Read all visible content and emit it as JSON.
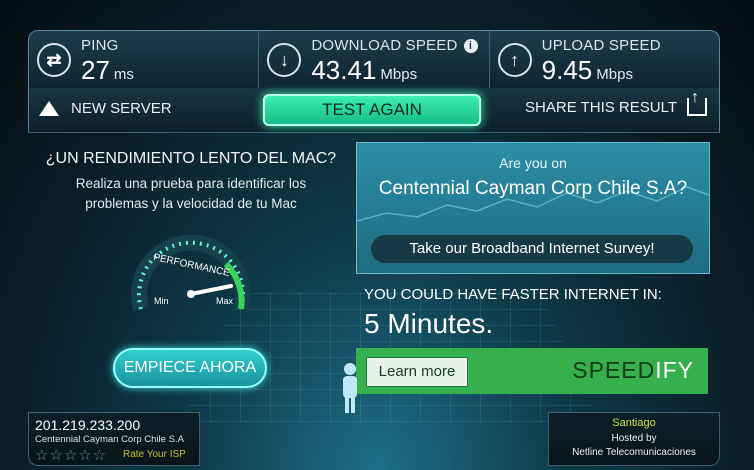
{
  "stats": [
    {
      "label": "PING",
      "value": "27",
      "unit": "ms",
      "icon": "ping-icon",
      "symbol": "⇄"
    },
    {
      "label": "DOWNLOAD SPEED",
      "value": "43.41",
      "unit": "Mbps",
      "icon": "download-arrow-icon",
      "symbol": "↓",
      "info": "i"
    },
    {
      "label": "UPLOAD SPEED",
      "value": "9.45",
      "unit": "Mbps",
      "icon": "upload-arrow-icon",
      "symbol": "↑"
    }
  ],
  "actions": {
    "new_server": "NEW SERVER",
    "test_again": "TEST AGAIN",
    "share": "SHARE THIS RESULT"
  },
  "mac_panel": {
    "title": "¿UN RENDIMIENTO LENTO DEL MAC?",
    "text": "Realiza una prueba para identificar los problemas y la velocidad de tu Mac",
    "gauge_label": "PERFORMANCE",
    "gauge_min": "Min",
    "gauge_max": "Max",
    "button": "EMPIECE AHORA"
  },
  "survey": {
    "question": "Are you on",
    "isp_name": "Centennial Cayman Corp Chile S.A?",
    "button": "Take our Broadband Internet Survey!"
  },
  "faster": {
    "line1": "YOU COULD HAVE FASTER INTERNET IN:",
    "line2": "5 Minutes."
  },
  "speedify": {
    "learn_more": "Learn more",
    "brand_dark": "SPEED",
    "brand_light": "IFY"
  },
  "isp_box": {
    "ip": "201.219.233.200",
    "name": "Centennial Cayman Corp Chile S.A",
    "stars": "☆☆☆☆☆",
    "rating_fraction": 0,
    "rate_label": "Rate Your ISP"
  },
  "host_box": {
    "city": "Santiago",
    "hosted_by": "Hosted by",
    "sponsor": "Netline Telecomunicaciones"
  },
  "colors": {
    "accent_green": "#3ff2b6",
    "speedify_green": "#35b04c",
    "survey_blue": "#2c8ea6"
  }
}
